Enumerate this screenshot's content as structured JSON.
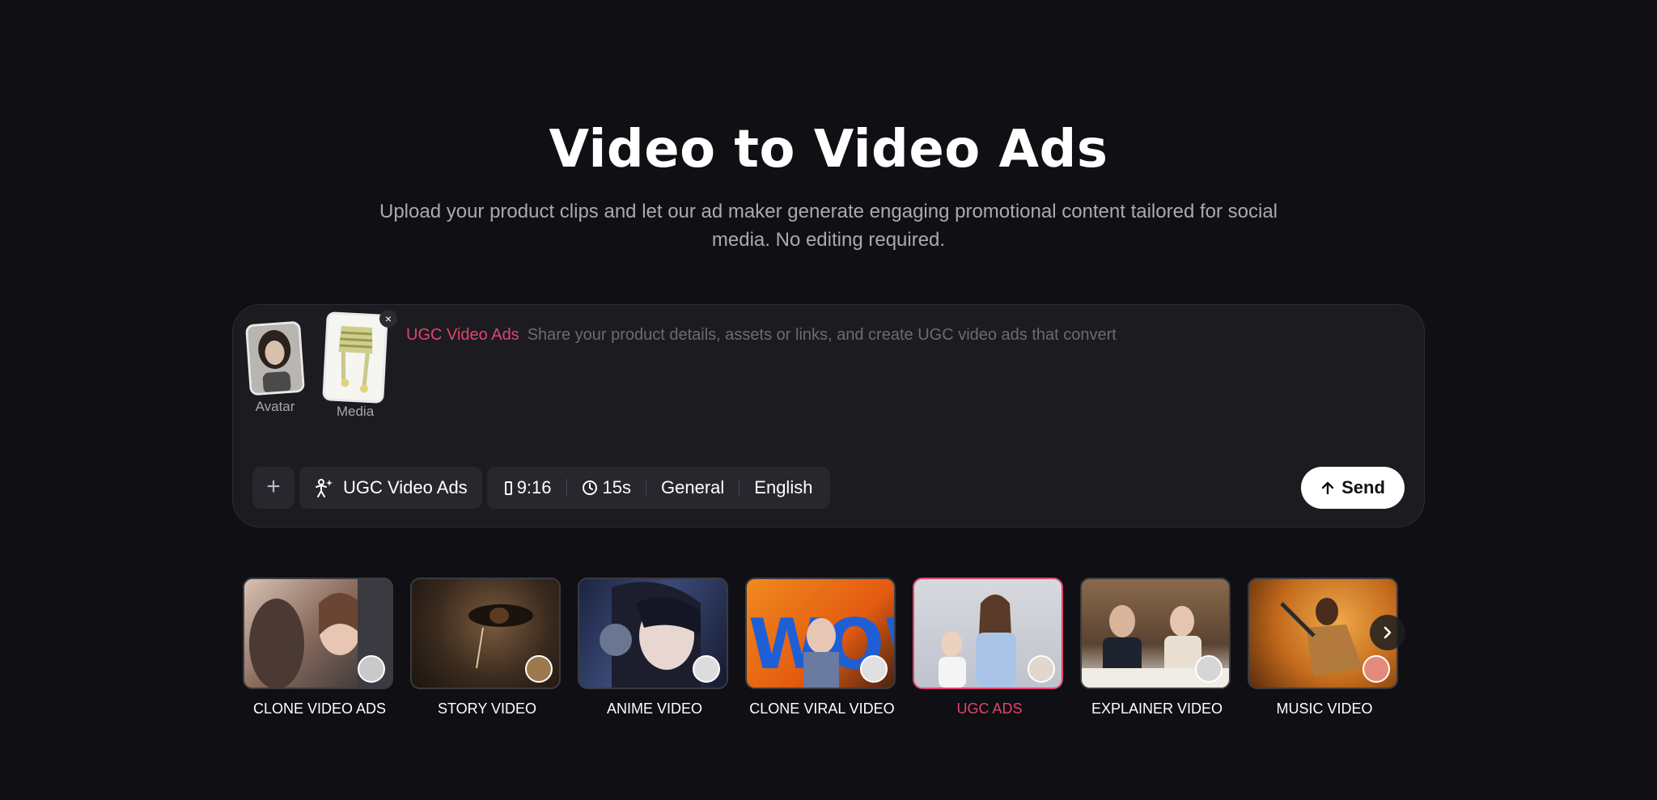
{
  "hero": {
    "title": "Video to Video Ads",
    "subtitle": "Upload your product clips and let our ad maker generate engaging promotional content tailored for social media. No editing required."
  },
  "composer": {
    "attachments": [
      {
        "label": "Avatar"
      },
      {
        "label": "Media",
        "remove_icon": "×"
      }
    ],
    "prompt_tag": "UGC Video Ads",
    "prompt_placeholder": "Share your product details, assets or links, and create UGC video ads that convert",
    "toolbar": {
      "add_icon": "+",
      "mode_label": "UGC Video Ads",
      "aspect_ratio": "9:16",
      "duration": "15s",
      "style": "General",
      "language": "English"
    },
    "send_label": "Send"
  },
  "templates": [
    {
      "label": "CLONE VIDEO ADS",
      "active": false
    },
    {
      "label": "STORY VIDEO",
      "active": false
    },
    {
      "label": "ANIME VIDEO",
      "active": false
    },
    {
      "label": "CLONE VIRAL VIDEO",
      "active": false
    },
    {
      "label": "UGC ADS",
      "active": true
    },
    {
      "label": "EXPLAINER VIDEO",
      "active": false
    },
    {
      "label": "MUSIC VIDEO",
      "active": false
    }
  ],
  "colors": {
    "background": "#0f0f14",
    "accent": "#e2446d",
    "panel": "#1b1b20"
  }
}
